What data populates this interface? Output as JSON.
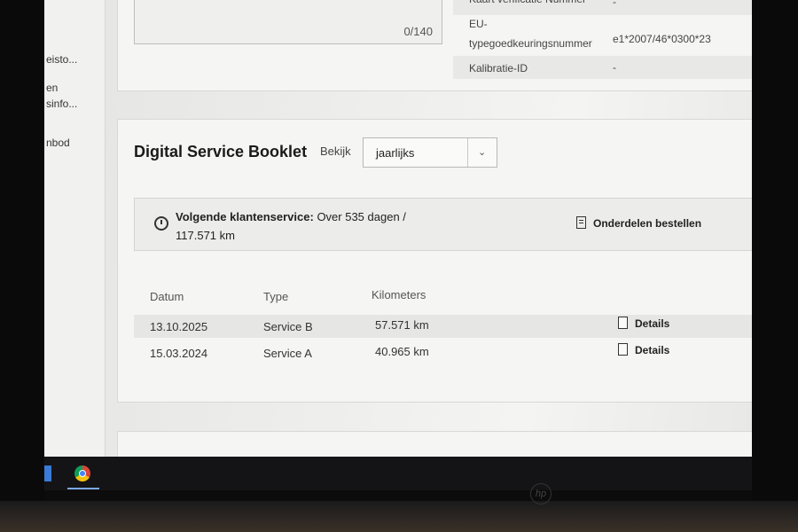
{
  "sidebar": {
    "items": [
      {
        "label": "eisto..."
      },
      {
        "label": "en"
      },
      {
        "label": "sinfo..."
      },
      {
        "label": "nbod"
      }
    ]
  },
  "top_card": {
    "counter": "0/140",
    "specs": [
      {
        "label": "Kaart verificatie Nummer",
        "value": "-"
      },
      {
        "label": "EU-",
        "label2": "typegoedkeuringsnummer",
        "value": "e1*2007/46*0300*23"
      },
      {
        "label": "Kalibratie-ID",
        "value": "-"
      }
    ]
  },
  "booklet": {
    "title": "Digital Service Booklet",
    "view_label": "Bekijk",
    "view_value": "jaarlijks",
    "notice_bold": "Volgende klantenservice:",
    "notice_rest": " Over 535 dagen /",
    "notice_line2": "117.571 km",
    "order_label": "Onderdelen bestellen",
    "columns": [
      "Datum",
      "Type",
      "Kilometers"
    ],
    "rows": [
      {
        "date": "13.10.2025",
        "type": "Service B",
        "km": "57.571 km",
        "details": "Details"
      },
      {
        "date": "15.03.2024",
        "type": "Service A",
        "km": "40.965 km",
        "details": "Details"
      }
    ]
  },
  "taskbar": {
    "brand": "hp"
  }
}
